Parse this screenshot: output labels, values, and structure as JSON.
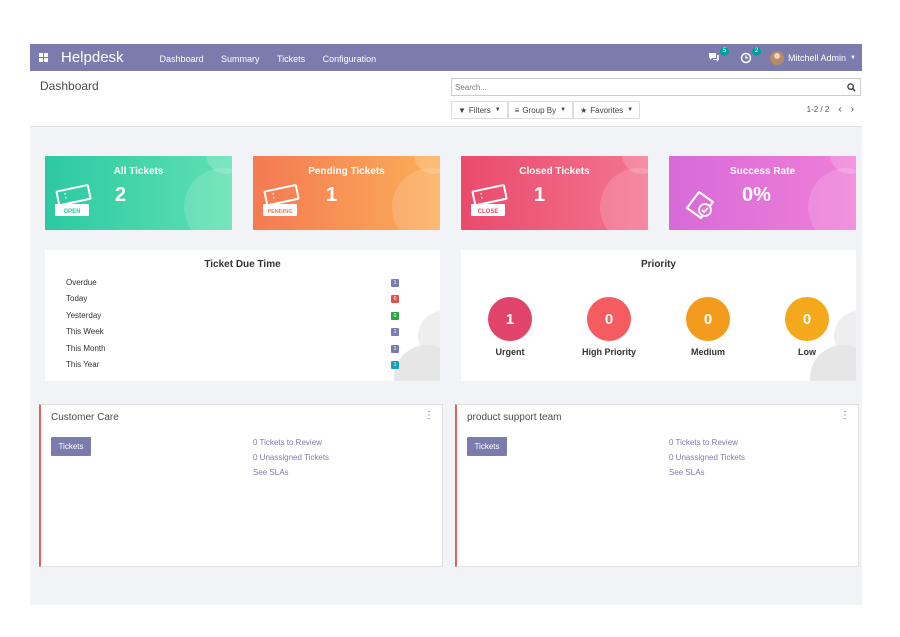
{
  "navbar": {
    "app_name": "Helpdesk",
    "menu": [
      "Dashboard",
      "Summary",
      "Tickets",
      "Configuration"
    ],
    "messages_badge": "5",
    "activity_badge": "2",
    "user_name": "Mitchell Admin"
  },
  "control": {
    "title": "Dashboard",
    "search_placeholder": "Search...",
    "filters_label": "Filters",
    "groupby_label": "Group By",
    "favorites_label": "Favorites",
    "pager": "1-2 / 2"
  },
  "cards": {
    "all": {
      "title": "All Tickets",
      "value": "2",
      "tag": "OPEN"
    },
    "pending": {
      "title": "Pending Tickets",
      "value": "1",
      "tag": "PENDING"
    },
    "closed": {
      "title": "Closed Tickets",
      "value": "1",
      "tag": "CLOSE"
    },
    "success": {
      "title": "Success Rate",
      "value": "0%"
    }
  },
  "due": {
    "title": "Ticket Due Time",
    "rows": [
      {
        "label": "Overdue",
        "count": "1",
        "color": "#7c7bad"
      },
      {
        "label": "Today",
        "count": "0",
        "color": "#d9534f"
      },
      {
        "label": "Yesterday",
        "count": "0",
        "color": "#28a745"
      },
      {
        "label": "This Week",
        "count": "1",
        "color": "#7c7bad"
      },
      {
        "label": "This Month",
        "count": "1",
        "color": "#7c7bad"
      },
      {
        "label": "This Year",
        "count": "1",
        "color": "#17a2b8"
      }
    ]
  },
  "priority": {
    "title": "Priority",
    "items": [
      {
        "label": "Urgent",
        "value": "1",
        "color": "#e0446a"
      },
      {
        "label": "High Priority",
        "value": "0",
        "color": "#f45c5f"
      },
      {
        "label": "Medium",
        "value": "0",
        "color": "#f39b1c"
      },
      {
        "label": "Low",
        "value": "0",
        "color": "#f4a81c"
      }
    ]
  },
  "teams": [
    {
      "name": "Customer Care",
      "button": "Tickets",
      "review": "0 Tickets to Review",
      "unassigned": "0 Unassigned Tickets",
      "slas": "See SLAs"
    },
    {
      "name": "product support team",
      "button": "Tickets",
      "review": "0 Tickets to Review",
      "unassigned": "0 Unassigned Tickets",
      "slas": "See SLAs"
    }
  ],
  "colors": {
    "brand": "#7c7bad",
    "team_border": "#e4625a"
  }
}
